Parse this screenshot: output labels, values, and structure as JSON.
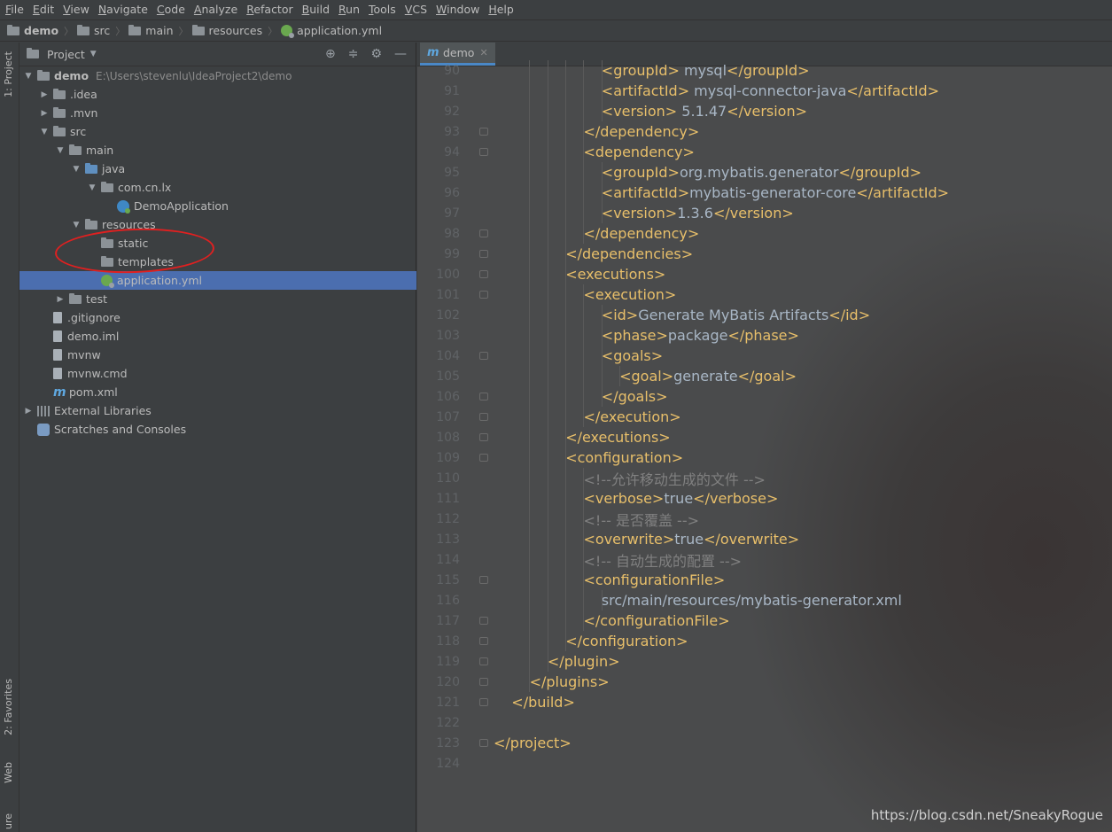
{
  "menu": [
    "File",
    "Edit",
    "View",
    "Navigate",
    "Code",
    "Analyze",
    "Refactor",
    "Build",
    "Run",
    "Tools",
    "VCS",
    "Window",
    "Help"
  ],
  "breadcrumb": [
    "demo",
    "src",
    "main",
    "resources",
    "application.yml"
  ],
  "left_stripe": {
    "project": "1: Project",
    "favorites": "2: Favorites",
    "web": "Web",
    "structure": "ure"
  },
  "project_panel": {
    "title": "Project",
    "tree": [
      {
        "label": "demo",
        "path": "E:\\Users\\stevenlu\\IdeaProject2\\demo",
        "depth": 0,
        "arrow": "down",
        "icon": "folder",
        "bold": true
      },
      {
        "label": ".idea",
        "depth": 1,
        "arrow": "right",
        "icon": "folder"
      },
      {
        "label": ".mvn",
        "depth": 1,
        "arrow": "right",
        "icon": "folder"
      },
      {
        "label": "src",
        "depth": 1,
        "arrow": "down",
        "icon": "folder"
      },
      {
        "label": "main",
        "depth": 2,
        "arrow": "down",
        "icon": "folder"
      },
      {
        "label": "java",
        "depth": 3,
        "arrow": "down",
        "icon": "folder-blue"
      },
      {
        "label": "com.cn.lx",
        "depth": 4,
        "arrow": "down",
        "icon": "folder"
      },
      {
        "label": "DemoApplication",
        "depth": 5,
        "arrow": "",
        "icon": "java-class"
      },
      {
        "label": "resources",
        "depth": 3,
        "arrow": "down",
        "icon": "folder"
      },
      {
        "label": "static",
        "depth": 4,
        "arrow": "",
        "icon": "folder"
      },
      {
        "label": "templates",
        "depth": 4,
        "arrow": "",
        "icon": "folder"
      },
      {
        "label": "application.yml",
        "depth": 4,
        "arrow": "",
        "icon": "yml",
        "selected": true
      },
      {
        "label": "test",
        "depth": 2,
        "arrow": "right",
        "icon": "folder"
      },
      {
        "label": ".gitignore",
        "depth": 1,
        "arrow": "",
        "icon": "file"
      },
      {
        "label": "demo.iml",
        "depth": 1,
        "arrow": "",
        "icon": "file"
      },
      {
        "label": "mvnw",
        "depth": 1,
        "arrow": "",
        "icon": "file"
      },
      {
        "label": "mvnw.cmd",
        "depth": 1,
        "arrow": "",
        "icon": "file"
      },
      {
        "label": "pom.xml",
        "depth": 1,
        "arrow": "",
        "icon": "maven"
      },
      {
        "label": "External Libraries",
        "depth": 0,
        "arrow": "right",
        "icon": "libraries"
      },
      {
        "label": "Scratches and Consoles",
        "depth": 0,
        "arrow": "",
        "icon": "scratches"
      }
    ]
  },
  "editor": {
    "tab": "demo",
    "lines": [
      {
        "n": 90,
        "indent": 6,
        "parts": [
          [
            "tg",
            "<groupId>"
          ],
          [
            "tx",
            " mysql"
          ],
          [
            "tg",
            "</groupId>"
          ]
        ]
      },
      {
        "n": 91,
        "indent": 6,
        "parts": [
          [
            "tg",
            "<artifactId>"
          ],
          [
            "tx",
            " mysql-connector-java"
          ],
          [
            "tg",
            "</artifactId>"
          ]
        ]
      },
      {
        "n": 92,
        "indent": 6,
        "parts": [
          [
            "tg",
            "<version>"
          ],
          [
            "tx",
            " 5.1.47"
          ],
          [
            "tg",
            "</version>"
          ]
        ]
      },
      {
        "n": 93,
        "indent": 5,
        "parts": [
          [
            "tg",
            "</dependency>"
          ]
        ],
        "fold": true
      },
      {
        "n": 94,
        "indent": 5,
        "parts": [
          [
            "tg",
            "<dependency>"
          ]
        ],
        "fold": true
      },
      {
        "n": 95,
        "indent": 6,
        "parts": [
          [
            "tg",
            "<groupId>"
          ],
          [
            "tx",
            "org.mybatis.generator"
          ],
          [
            "tg",
            "</groupId>"
          ]
        ]
      },
      {
        "n": 96,
        "indent": 6,
        "parts": [
          [
            "tg",
            "<artifactId>"
          ],
          [
            "tx",
            "mybatis-generator-core"
          ],
          [
            "tg",
            "</artifactId>"
          ]
        ]
      },
      {
        "n": 97,
        "indent": 6,
        "parts": [
          [
            "tg",
            "<version>"
          ],
          [
            "tx",
            "1.3.6"
          ],
          [
            "tg",
            "</version>"
          ]
        ]
      },
      {
        "n": 98,
        "indent": 5,
        "parts": [
          [
            "tg",
            "</dependency>"
          ]
        ],
        "fold": true
      },
      {
        "n": 99,
        "indent": 4,
        "parts": [
          [
            "tg",
            "</dependencies>"
          ]
        ],
        "fold": true
      },
      {
        "n": 100,
        "indent": 4,
        "parts": [
          [
            "tg",
            "<executions>"
          ]
        ],
        "fold": true
      },
      {
        "n": 101,
        "indent": 5,
        "parts": [
          [
            "tg",
            "<execution>"
          ]
        ],
        "fold": true
      },
      {
        "n": 102,
        "indent": 6,
        "parts": [
          [
            "tg",
            "<id>"
          ],
          [
            "tx",
            "Generate MyBatis Artifacts"
          ],
          [
            "tg",
            "</id>"
          ]
        ]
      },
      {
        "n": 103,
        "indent": 6,
        "parts": [
          [
            "tg",
            "<phase>"
          ],
          [
            "tx",
            "package"
          ],
          [
            "tg",
            "</phase>"
          ]
        ]
      },
      {
        "n": 104,
        "indent": 6,
        "parts": [
          [
            "tg",
            "<goals>"
          ]
        ],
        "fold": true
      },
      {
        "n": 105,
        "indent": 7,
        "parts": [
          [
            "tg",
            "<goal>"
          ],
          [
            "tx",
            "generate"
          ],
          [
            "tg",
            "</goal>"
          ]
        ]
      },
      {
        "n": 106,
        "indent": 6,
        "parts": [
          [
            "tg",
            "</goals>"
          ]
        ],
        "fold": true
      },
      {
        "n": 107,
        "indent": 5,
        "parts": [
          [
            "tg",
            "</execution>"
          ]
        ],
        "fold": true
      },
      {
        "n": 108,
        "indent": 4,
        "parts": [
          [
            "tg",
            "</executions>"
          ]
        ],
        "fold": true
      },
      {
        "n": 109,
        "indent": 4,
        "parts": [
          [
            "tg",
            "<configuration>"
          ]
        ],
        "fold": true
      },
      {
        "n": 110,
        "indent": 5,
        "parts": [
          [
            "cm",
            "<!--允许移动生成的文件 -->"
          ]
        ]
      },
      {
        "n": 111,
        "indent": 5,
        "parts": [
          [
            "tg",
            "<verbose>"
          ],
          [
            "tx",
            "true"
          ],
          [
            "tg",
            "</verbose>"
          ]
        ]
      },
      {
        "n": 112,
        "indent": 5,
        "parts": [
          [
            "cm",
            "<!-- 是否覆盖 -->"
          ]
        ]
      },
      {
        "n": 113,
        "indent": 5,
        "parts": [
          [
            "tg",
            "<overwrite>"
          ],
          [
            "tx",
            "true"
          ],
          [
            "tg",
            "</overwrite>"
          ]
        ]
      },
      {
        "n": 114,
        "indent": 5,
        "parts": [
          [
            "cm",
            "<!-- 自动生成的配置 -->"
          ]
        ]
      },
      {
        "n": 115,
        "indent": 5,
        "parts": [
          [
            "tg",
            "<configurationFile>"
          ]
        ],
        "fold": true
      },
      {
        "n": 116,
        "indent": 6,
        "parts": [
          [
            "tx",
            "src/main/resources/mybatis-generator.xml"
          ]
        ]
      },
      {
        "n": 117,
        "indent": 5,
        "parts": [
          [
            "tg",
            "</configurationFile>"
          ]
        ],
        "fold": true
      },
      {
        "n": 118,
        "indent": 4,
        "parts": [
          [
            "tg",
            "</configuration>"
          ]
        ],
        "fold": true
      },
      {
        "n": 119,
        "indent": 3,
        "parts": [
          [
            "tg",
            "</plugin>"
          ]
        ],
        "fold": true
      },
      {
        "n": 120,
        "indent": 2,
        "parts": [
          [
            "tg",
            "</plugins>"
          ]
        ],
        "fold": true
      },
      {
        "n": 121,
        "indent": 1,
        "parts": [
          [
            "tg",
            "</build>"
          ]
        ],
        "fold": true
      },
      {
        "n": 122,
        "indent": 0,
        "parts": []
      },
      {
        "n": 123,
        "indent": 0,
        "parts": [
          [
            "tg",
            "</project>"
          ]
        ],
        "fold": true
      },
      {
        "n": 124,
        "indent": 0,
        "parts": []
      }
    ]
  },
  "watermark": "https://blog.csdn.net/SneakyRogue",
  "colors": {
    "tag": "#e8bf6a",
    "text": "#a9b7c6",
    "comment": "#808080",
    "selection": "#4b6eaf",
    "annotation": "#e02020"
  }
}
